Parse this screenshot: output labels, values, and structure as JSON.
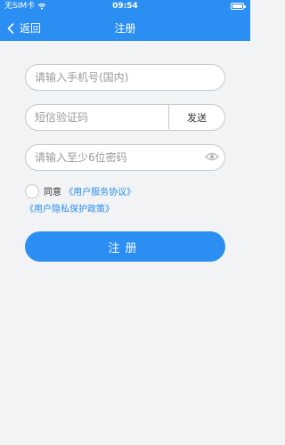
{
  "status_bar": {
    "carrier": "无SIM卡",
    "time": "09:54",
    "wifi_icon": "wifi-icon",
    "battery_icon": "battery-icon"
  },
  "nav": {
    "back_label": "返回",
    "title": "注册"
  },
  "form": {
    "phone_placeholder": "请输入手机号(国内)",
    "sms_placeholder": "短信验证码",
    "send_label": "发送",
    "password_placeholder": "请输入至少6位密码"
  },
  "agreement": {
    "prefix": "同意",
    "user_agreement": "《用户服务协议》",
    "privacy_policy": "《用户隐私保护政策》"
  },
  "register_label": "注册",
  "colors": {
    "primary": "#2b8ef2",
    "background": "#f2f3f5",
    "border": "#c6c8cc"
  }
}
